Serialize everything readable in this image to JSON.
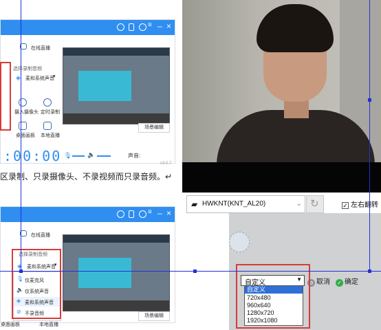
{
  "document": {
    "body_text": "区录制、只录摄像头、不录视频而只录音频。↵"
  },
  "recorder_top": {
    "online_live": "在线直播",
    "section_label": "选择录制音频",
    "audio_mode": "麦和系统声音",
    "sources": [
      {
        "label": "摄入摄像头"
      },
      {
        "label": "定时录制"
      },
      {
        "label": "桌面画板"
      },
      {
        "label": "本地直播"
      }
    ],
    "scene_edit": "场景编辑",
    "timer": ":00:00",
    "volume_label": "声音:",
    "version": "v3.0.7"
  },
  "recorder_bottom": {
    "online_live": "在线直播",
    "section_label": "选择录制音频",
    "audio_mode": "麦和系统声音",
    "audio_options": [
      {
        "label": "仅麦克风"
      },
      {
        "label": "仅系统声音"
      },
      {
        "label": "麦和系统声音"
      },
      {
        "label": "不录音频"
      }
    ],
    "side_label": "桌面画板",
    "side_label2": "本地直播",
    "scene_edit": "场景编辑"
  },
  "camera_panel": {
    "device_name": "HWKNT(KNT_AL20)",
    "mirror_label": "左右翻转",
    "mirror_checked": true,
    "resolution_selected": "自定义",
    "resolution_options": [
      "自定义",
      "720x480",
      "960x640",
      "1280x720",
      "1920x1080"
    ],
    "cancel_label": "取消",
    "confirm_label": "确定"
  },
  "colors": {
    "title_bar": "#2f8ef0",
    "selection_line": "#2430d8",
    "highlight_red": "#d83a3a"
  }
}
